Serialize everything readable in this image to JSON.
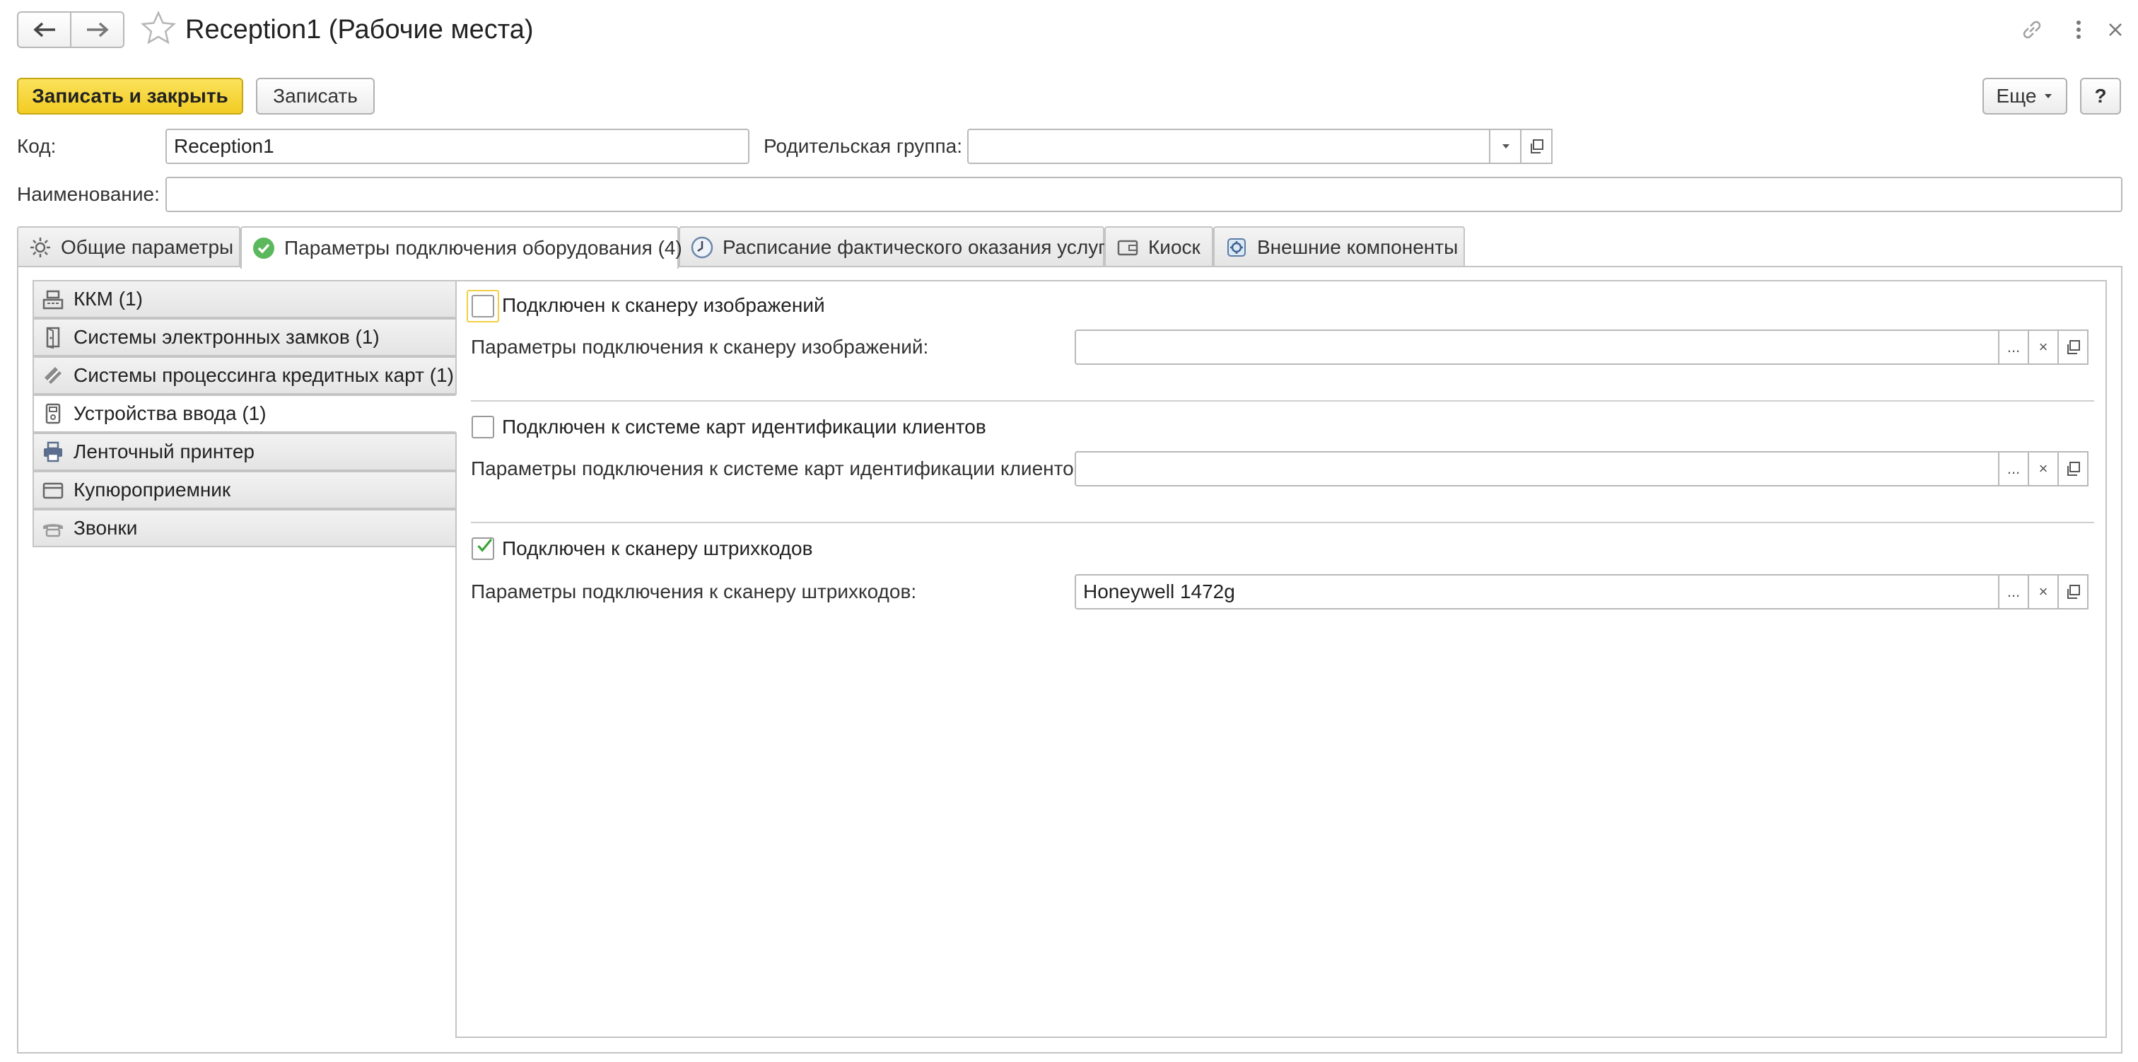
{
  "window": {
    "title": "Reception1 (Рабочие места)",
    "icons": {
      "back": "arrow-left-icon",
      "forward": "arrow-right-icon",
      "favorite": "star-icon",
      "link": "link-icon",
      "more": "more-vertical-icon",
      "close": "close-icon"
    }
  },
  "toolbar": {
    "save_close_label": "Записать и закрыть",
    "save_label": "Записать",
    "more_label": "Еще",
    "help_label": "?"
  },
  "form": {
    "code_label": "Код:",
    "code_value": "Reception1",
    "parent_label": "Родительская группа:",
    "parent_value": "",
    "name_label": "Наименование:",
    "name_value": ""
  },
  "tabs": [
    {
      "label": "Общие параметры",
      "icon": "gear-icon"
    },
    {
      "label": "Параметры подключения оборудования (4)",
      "icon": "check-circle-icon"
    },
    {
      "label": "Расписание фактического оказания услуг",
      "icon": "clock-icon"
    },
    {
      "label": "Киоск",
      "icon": "wallet-icon"
    },
    {
      "label": "Внешние компоненты",
      "icon": "components-icon"
    }
  ],
  "sidebar": {
    "items": [
      {
        "label": "ККМ (1)",
        "icon": "cash-register-icon"
      },
      {
        "label": "Системы электронных замков (1)",
        "icon": "door-icon"
      },
      {
        "label": "Системы процессинга кредитных карт (1)",
        "icon": "credit-card-icon"
      },
      {
        "label": "Устройства ввода (1)",
        "icon": "input-device-icon"
      },
      {
        "label": "Ленточный принтер",
        "icon": "printer-icon"
      },
      {
        "label": "Купюроприемник",
        "icon": "bill-acceptor-icon"
      },
      {
        "label": "Звонки",
        "icon": "phone-icon"
      }
    ]
  },
  "devices": [
    {
      "checkbox_label": "Подключен к сканеру изображений",
      "checked": false,
      "params_label": "Параметры подключения к сканеру изображений:",
      "params_value": ""
    },
    {
      "checkbox_label": "Подключен к системе карт идентификации клиентов",
      "checked": false,
      "params_label": "Параметры подключения к системе карт идентификации клиентов:",
      "params_value": ""
    },
    {
      "checkbox_label": "Подключен к сканеру штрихкодов",
      "checked": true,
      "params_label": "Параметры подключения к сканеру штрихкодов:",
      "params_value": "Honeywell 1472g"
    }
  ],
  "field_buttons": {
    "select": "...",
    "clear": "×"
  },
  "colors": {
    "accent_yellow": "#f2cc24",
    "check_green": "#3aa537",
    "tab_icon_green": "#5cb85c"
  }
}
